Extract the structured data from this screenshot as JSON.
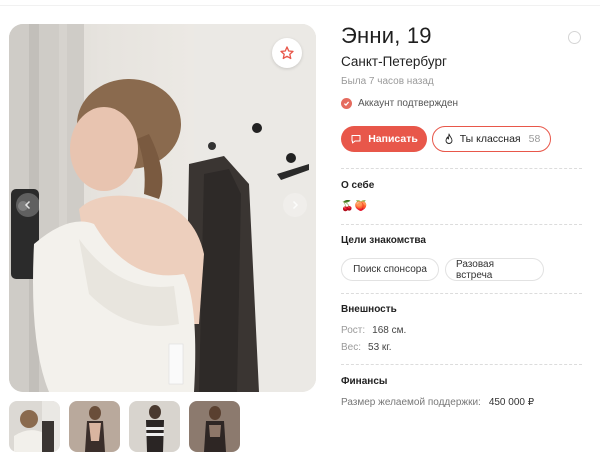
{
  "profile": {
    "name_age": "Энни, 19",
    "city": "Санкт-Петербург",
    "last_seen": "Была 7 часов назад",
    "verified_label": "Аккаунт подтвержден"
  },
  "actions": {
    "write_label": "Написать",
    "like_label": "Ты классная",
    "like_count": "58"
  },
  "sections": {
    "about": {
      "title": "О себе",
      "emojis": [
        "🍒",
        "🍑"
      ]
    },
    "goals": {
      "title": "Цели знакомства",
      "chips": [
        "Поиск спонсора",
        "Разовая встреча"
      ]
    },
    "appearance": {
      "title": "Внешность",
      "height_label": "Рост:",
      "height_value": "168 см.",
      "weight_label": "Вес:",
      "weight_value": "53 кг."
    },
    "finance": {
      "title": "Финансы",
      "support_label": "Размер желаемой поддержки:",
      "support_value": "450 000 ₽"
    }
  },
  "gallery": {
    "photo_count": 4,
    "active_index": 0
  },
  "icons": {
    "favorite": "star-icon",
    "message": "chat-bubble-icon",
    "like": "flame-icon",
    "verified": "check-badge-icon",
    "more": "circle-icon",
    "prev": "chevron-left-icon",
    "next": "chevron-right-icon"
  },
  "colors": {
    "accent": "#e8574a",
    "muted": "#9a9a9a"
  }
}
